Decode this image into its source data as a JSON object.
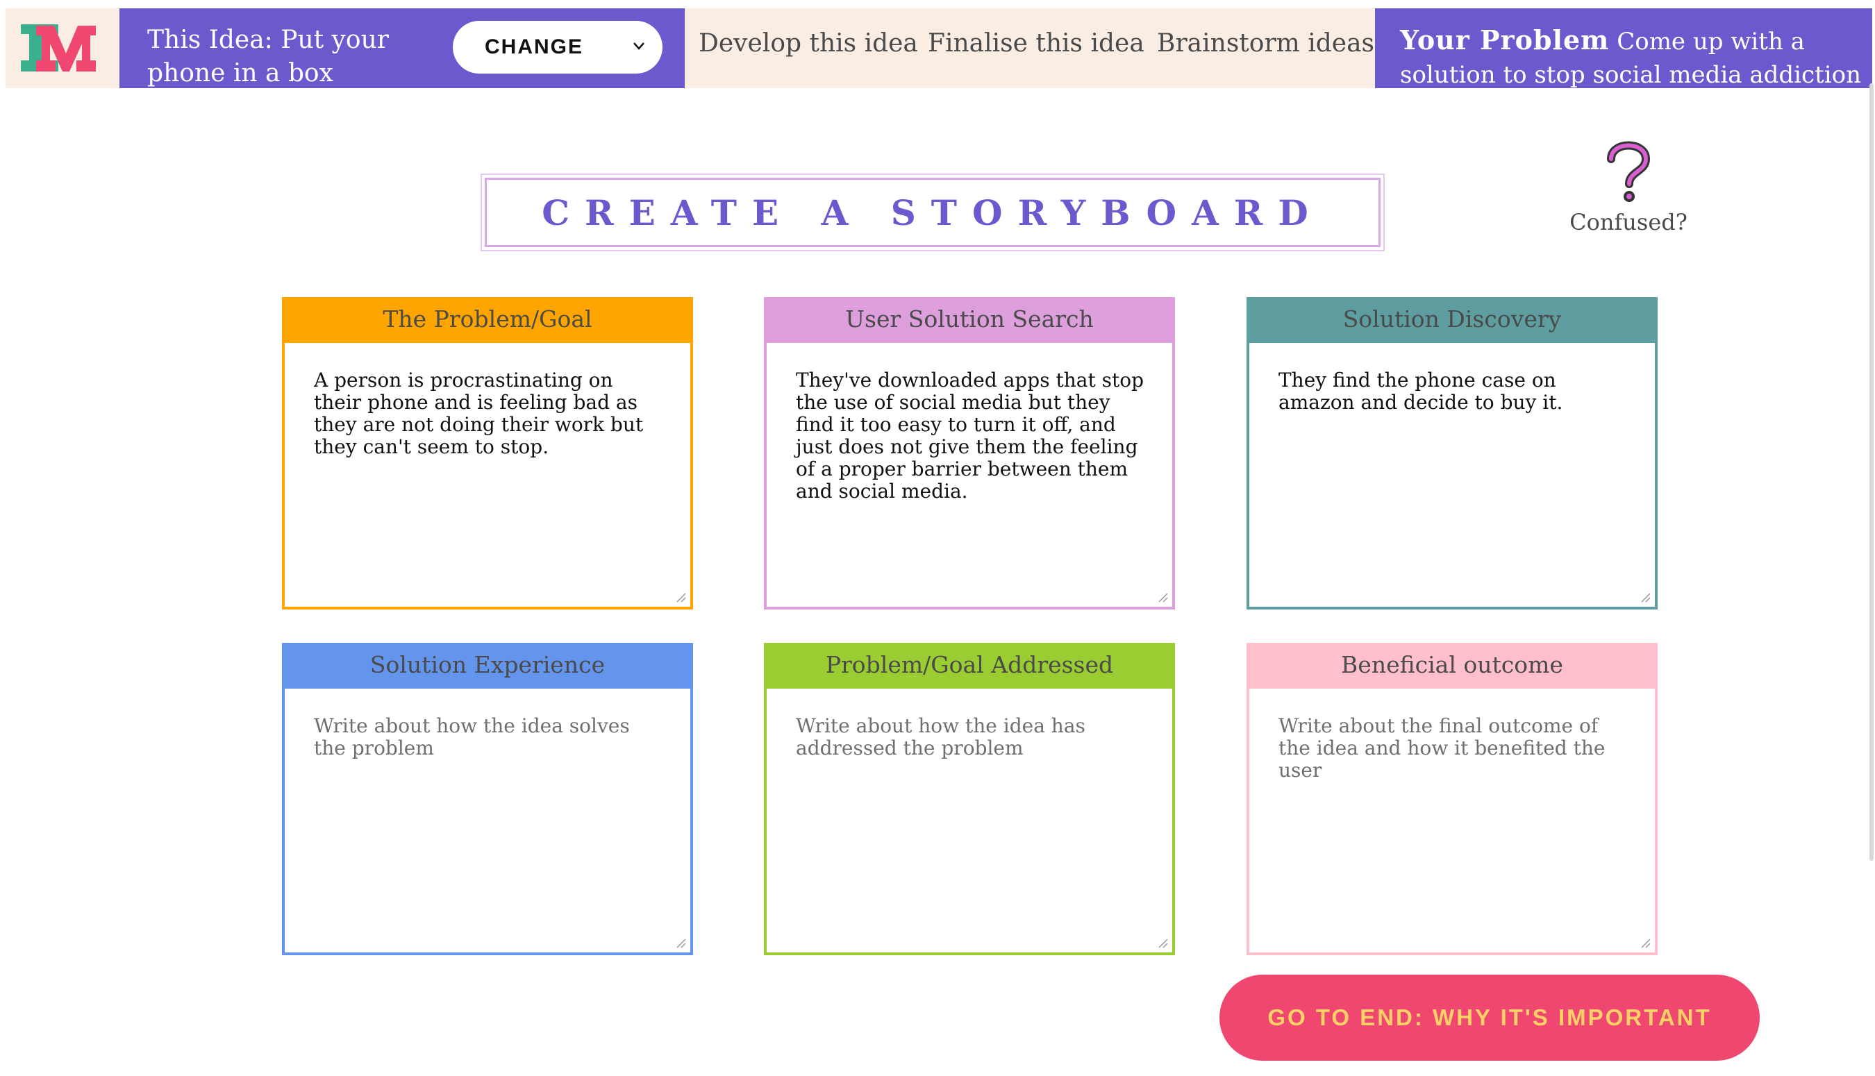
{
  "logo": {
    "letter": "M",
    "letter_accent": "I"
  },
  "header": {
    "idea_label": "This Idea: Put your phone in a box",
    "change_label": "CHANGE",
    "nav": [
      "Develop this idea",
      "Finalise this idea",
      "Brainstorm ideas"
    ],
    "problem_label": "Your Problem",
    "problem_text": "Come up with a solution to stop social media addiction"
  },
  "title": "Create a Storyboard",
  "help": {
    "label": "Confused?",
    "icon": "question-mark-icon"
  },
  "cards": [
    {
      "title": "The Problem/Goal",
      "color": "#ffa500",
      "text": "A person is procrastinating on their phone and is feeling bad as they are not doing their work but they can't seem to stop.",
      "placeholder": ""
    },
    {
      "title": "User Solution Search",
      "color": "#dda0dd",
      "text": "They've downloaded apps that stop the use of social media but they find it too easy to turn it off, and just does not give them the feeling of a proper barrier between them and social media.",
      "placeholder": ""
    },
    {
      "title": "Solution Discovery",
      "color": "#5f9ea0",
      "text": "They find the phone case on amazon and decide to buy it.",
      "placeholder": ""
    },
    {
      "title": "Solution Experience",
      "color": "#6495ed",
      "text": "",
      "placeholder": "Write about how the idea solves the problem"
    },
    {
      "title": "Problem/Goal Addressed",
      "color": "#9acd32",
      "text": "",
      "placeholder": "Write about how the idea has addressed the problem"
    },
    {
      "title": "Beneficial outcome",
      "color": "#ffc0cb",
      "text": "",
      "placeholder": "Write about the final outcome of the idea and how it benefited the user"
    }
  ],
  "end_button": "GO TO END: WHY IT'S IMPORTANT",
  "colors": {
    "purple": "#6a5acd",
    "cream": "#faeee4",
    "button_bg": "#ef476f",
    "button_text": "#ffd166"
  }
}
